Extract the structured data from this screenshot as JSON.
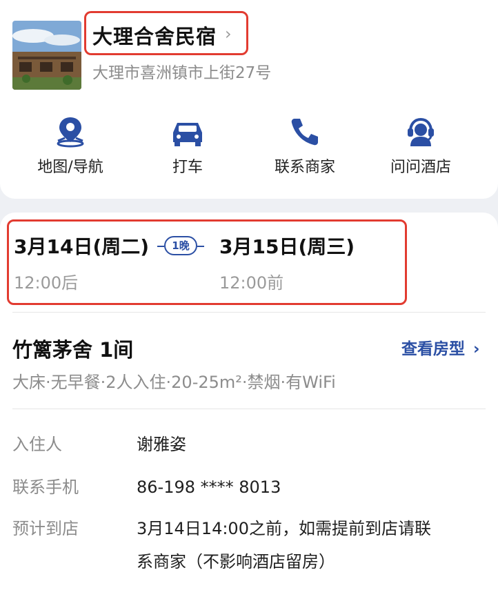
{
  "hotel": {
    "name": "大理合舍民宿",
    "address": "大理市喜洲镇市上街27号"
  },
  "actions": [
    {
      "label": "地图/导航",
      "icon": "map-pin-icon"
    },
    {
      "label": "打车",
      "icon": "car-icon"
    },
    {
      "label": "联系商家",
      "icon": "phone-icon"
    },
    {
      "label": "问问酒店",
      "icon": "headset-icon"
    }
  ],
  "stay": {
    "checkin_date": "3月14日(周二)",
    "checkin_time": "12:00后",
    "nights": "1晚",
    "checkout_date": "3月15日(周三)",
    "checkout_time": "12:00前"
  },
  "room": {
    "name": "竹篱茅舍 1间",
    "view_label": "查看房型",
    "specs": "大床·无早餐·2人入住·20-25m²·禁烟·有WiFi"
  },
  "guest": {
    "name_label": "入住人",
    "name_value": "谢雅姿",
    "phone_label": "联系手机",
    "phone_value": "86-198 **** 8013",
    "arrival_label": "预计到店",
    "arrival_line1": "3月14日14:00之前，如需提前到店请联",
    "arrival_line2": "系商家（不影响酒店留房）"
  },
  "colors": {
    "accent": "#2b4fa4",
    "highlight": "#e23b30",
    "muted": "#8c8c8c"
  }
}
